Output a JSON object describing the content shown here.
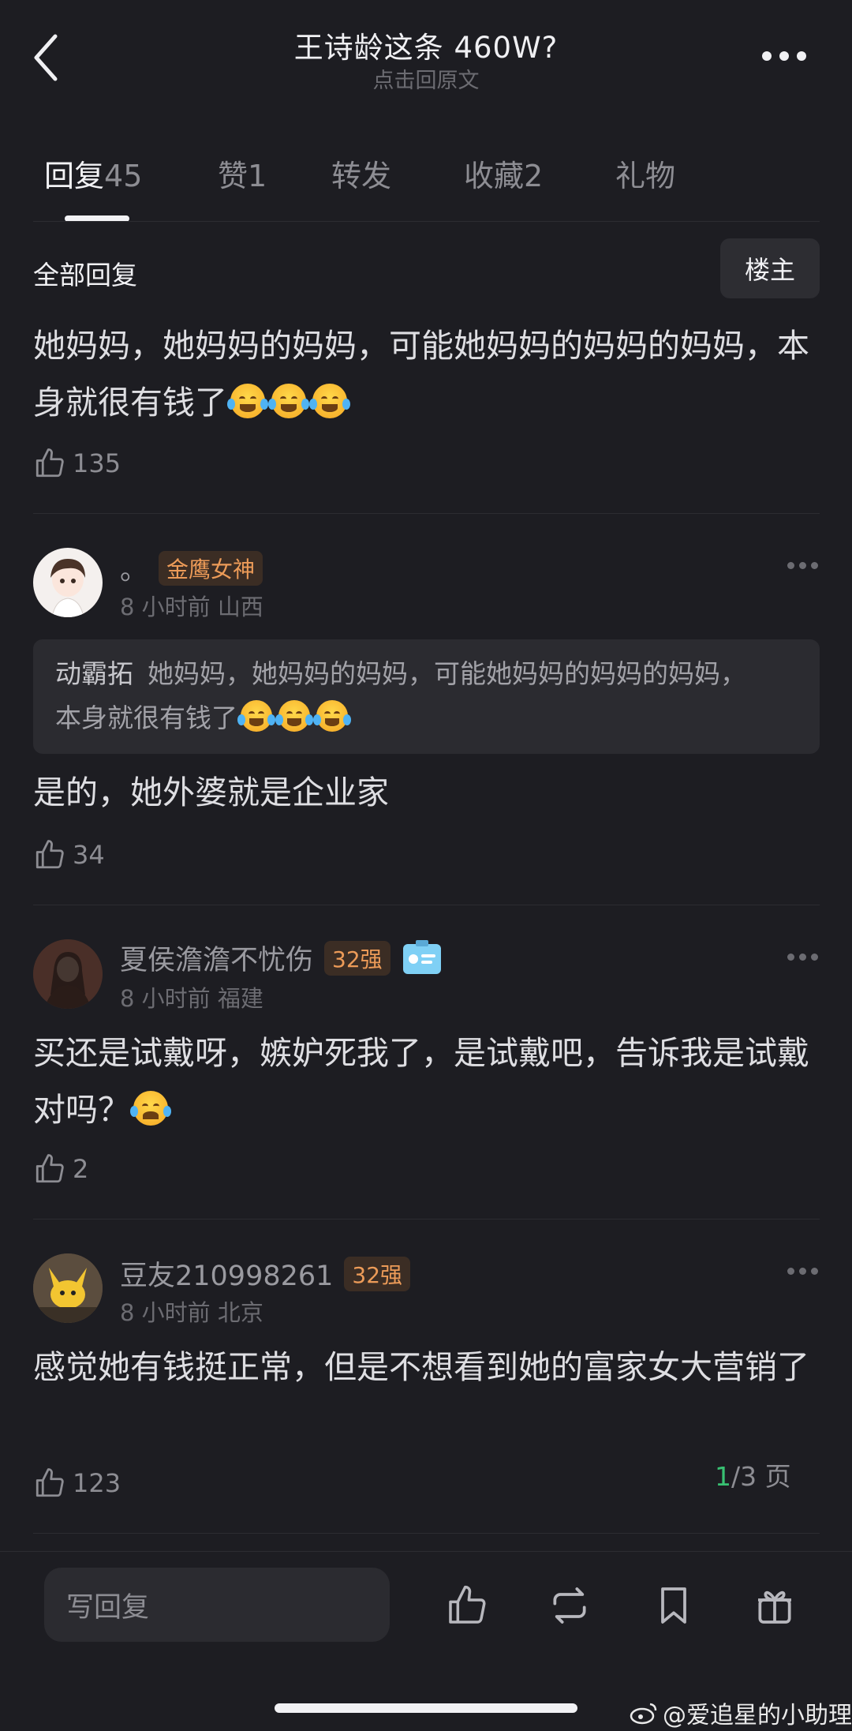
{
  "header": {
    "title": "王诗龄这条 460W?",
    "subtitle": "点击回原文"
  },
  "tabs": [
    {
      "label": "回复",
      "count": "45",
      "active": true
    },
    {
      "label": "赞",
      "count": "1"
    },
    {
      "label": "转发",
      "count": ""
    },
    {
      "label": "收藏",
      "count": "2"
    },
    {
      "label": "礼物",
      "count": ""
    }
  ],
  "section": {
    "title": "全部回复",
    "owner_button": "楼主"
  },
  "main_comment": {
    "text": "她妈妈，她妈妈的妈妈，可能她妈妈的妈妈的妈妈，本身就很有钱了",
    "likes": "135"
  },
  "comments": [
    {
      "username": "。",
      "badge": "金鹰女神",
      "meta": "8 小时前  山西",
      "quote_author": "动霸拓",
      "quote_text": "她妈妈，她妈妈的妈妈，可能她妈妈的妈妈的妈妈，本身就很有钱了",
      "text": "是的，她外婆就是企业家",
      "likes": "34"
    },
    {
      "username": "夏侯澹澹不忧伤",
      "badge": "32强",
      "meta": "8 小时前  福建",
      "text": "买还是试戴呀，嫉妒死我了，是试戴吧，告诉我是试戴对吗？",
      "likes": "2"
    },
    {
      "username": "豆友210998261",
      "badge": "32强",
      "meta": "8 小时前  北京",
      "text": "感觉她有钱挺正常，但是不想看到她的富家女大营销了",
      "likes": "123"
    }
  ],
  "pager": {
    "current": "1",
    "total": "/3 页"
  },
  "bottom_bar": {
    "reply_placeholder": "写回复",
    "icons": [
      "like-icon",
      "repost-icon",
      "bookmark-icon",
      "gift-icon"
    ]
  },
  "watermark": "@爱追星的小助理",
  "colors": {
    "background": "#1d1d22",
    "badge_text": "#ec9b58",
    "pager_current": "#38c172"
  }
}
